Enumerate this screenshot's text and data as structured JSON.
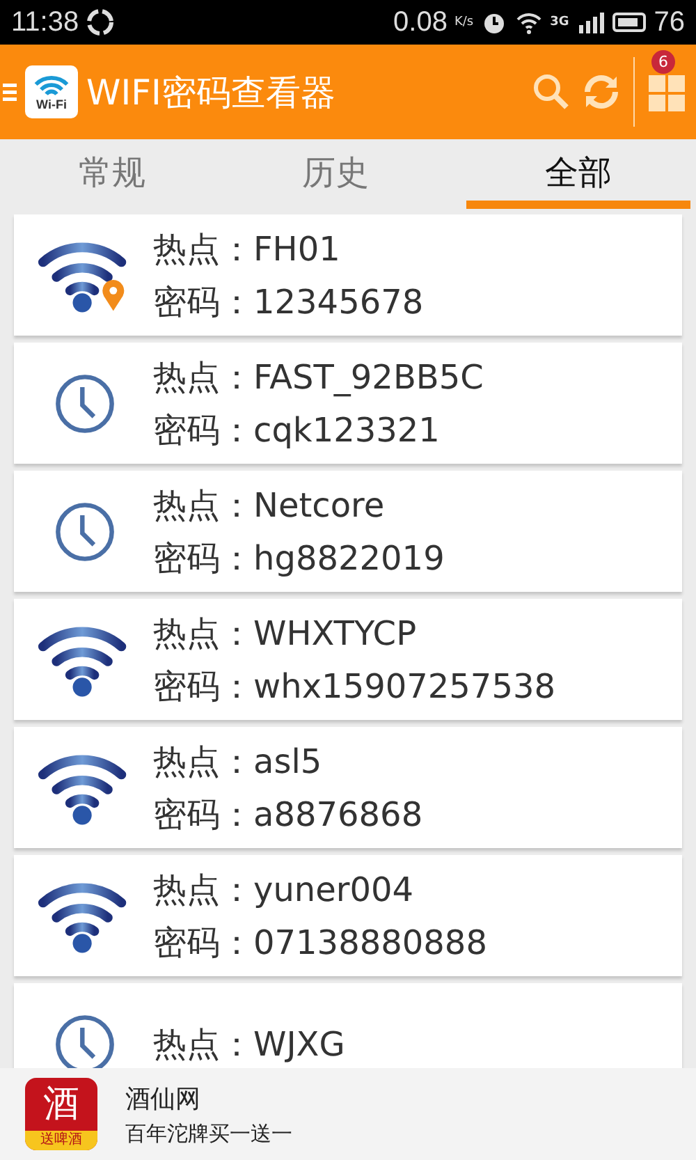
{
  "status_bar": {
    "time": "11:38",
    "speed": "0.08",
    "speed_unit": "K/s",
    "network": "3G",
    "battery": "76"
  },
  "app_bar": {
    "title": "WIFI密码查看器",
    "logo_text": "Wi-Fi",
    "badge": "6"
  },
  "tabs": [
    {
      "label": "常规",
      "selected": false
    },
    {
      "label": "历史",
      "selected": false
    },
    {
      "label": "全部",
      "selected": true
    }
  ],
  "networks": [
    {
      "kind": "wifi_pin",
      "hotspot_label": "热点：",
      "hotspot": "FH01",
      "password_label": "密码：",
      "password": "12345678"
    },
    {
      "kind": "clock",
      "hotspot_label": "热点：",
      "hotspot": "FAST_92BB5C",
      "password_label": "密码：",
      "password": "cqk123321"
    },
    {
      "kind": "clock",
      "hotspot_label": "热点：",
      "hotspot": "Netcore",
      "password_label": "密码：",
      "password": "hg8822019"
    },
    {
      "kind": "wifi",
      "hotspot_label": "热点：",
      "hotspot": "WHXTYCP",
      "password_label": "密码：",
      "password": "whx15907257538"
    },
    {
      "kind": "wifi",
      "hotspot_label": "热点：",
      "hotspot": "asl5",
      "password_label": "密码：",
      "password": "a8876868"
    },
    {
      "kind": "wifi",
      "hotspot_label": "热点：",
      "hotspot": "yuner004",
      "password_label": "密码：",
      "password": "07138880888"
    },
    {
      "kind": "clock",
      "hotspot_label": "热点：",
      "hotspot": "WJXG"
    }
  ],
  "ad": {
    "logo_char": "酒",
    "logo_caption": "送啤酒",
    "title": "酒仙网",
    "subtitle": "百年沱牌买一送一"
  }
}
